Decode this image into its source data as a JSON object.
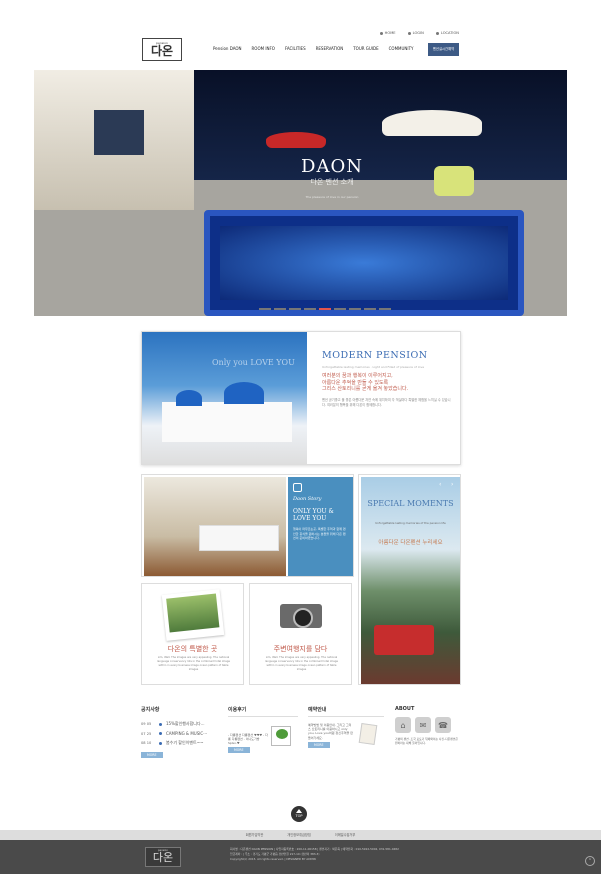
{
  "util": {
    "home": "HOME",
    "login": "LOGIN",
    "location": "LOCATION"
  },
  "logo": {
    "small": "pension",
    "big": "다온"
  },
  "gnb": [
    "Pension DAON",
    "ROOM INFO",
    "FACILITIES",
    "RESERVATION",
    "TOUR GUIDE",
    "COMMUNITY"
  ],
  "reserve_button": "펜션실시간예약",
  "hero": {
    "title": "DAON",
    "subtitle": "다온 펜션 소개",
    "desc": "The pleasure of love in our pension"
  },
  "intro": {
    "heading": "MODERN PENSION",
    "overlay": "Only you LOVE YOU",
    "en": "Unforgettable lasting memories · Light and Filled of pleasure of love",
    "kr1": "여러분의 꿈과 행복이 이루어지고,",
    "kr2": "아름다운 추억을 만들 수 있도록",
    "kr3": "그리스 산토리니를 곧게 옮겨 놓았습니다.",
    "body": "펜션 공기좋고 물 좋은 아름다운 자연 속에 위치하여 각 객실마다 특별한 체험을 느끼실 수 있습니다. 여러분의 행복을 위해 다온이 함께합니다."
  },
  "room": {
    "script": "Daon Story",
    "heading": "ONLY YOU & LOVE YOU",
    "body": "행복이 머무르는곳, 특별한 추억과 함께 편안한 휴식을 원하시는 분들을 위해 다온 펜션이 준비하였습니다."
  },
  "special": {
    "heading": "SPECIAL MOMENTS",
    "body": "Unforgettable lasting memories of the pension life",
    "kr": "아름다운 다온펜션 누리세요"
  },
  "card1": {
    "heading": "다온의 특별한 곳",
    "body": "Lim, Well. The images are very appealing. The national language conservancy lots in the combined hotel image within in every business image ocean pattern of table images"
  },
  "card2": {
    "heading": "주변여행지를 담다",
    "body": "Lim, Well. The images are very appealing. The national language conservancy lots in the combined hotel image within in every business image ocean pattern of table images"
  },
  "notice": {
    "title": "공지사항",
    "items": [
      {
        "date": "09 05",
        "text": "15%할인행사합니다..."
      },
      {
        "date": "07 25",
        "text": "CAMPING & MUSIC···"
      },
      {
        "date": "08 10",
        "text": "봄수기 할인이벤트~~"
      }
    ],
    "more": "MORE"
  },
  "review": {
    "title": "이용후기",
    "text": "- 다롱펜션 다롱펜션 ♥♥♥ - 다롱 다롱펜션 - 이니도가방 SpGo.♥",
    "more": "MORE"
  },
  "guide": {
    "title": "예약안내",
    "text": "예약방법 및 이용안내. 그리고 그리스 산토리니를 이용하시고 only you, Love you처럼 정신추억을 만들어가세요.",
    "more": "MORE"
  },
  "about": {
    "title": "ABOUT",
    "text": "가평의 펜션. 조국 포토기 뒤에와이는 사진-다온펜션은 원하라는 대해 둘어입니다."
  },
  "top": "TOP",
  "footer_links": [
    "회원가입약관",
    "개인정보취급방침",
    "이메일수집거부"
  ],
  "footer": {
    "line1": "회사명 : 다온펜션 DAON PENSION | 사업자등록번호 : 200-11-00158 | 펜션지기 : 박은옥 | 예약전화 : 010-5922-5002, 031-581-0482",
    "line2": "입금계좌 : | 주소 : 경기도 가평군 가평읍 경반안길 217-10 (경반리 383-3)",
    "line3": "Copyright(c) 2015. All rights reserved. | DESIGNED BY ADMIN"
  }
}
